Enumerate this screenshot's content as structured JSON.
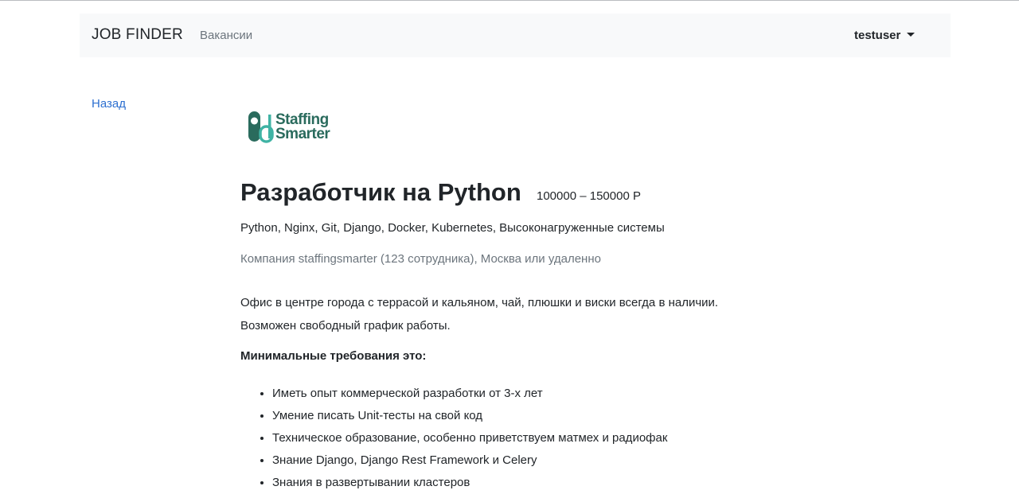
{
  "navbar": {
    "brand": "JOB FINDER",
    "vacancies_link": "Вакансии",
    "username": "testuser"
  },
  "back_link": "Назад",
  "company_logo": {
    "text_line1": "Staffing",
    "text_line2": "Smarter",
    "color": "#2a6b5d"
  },
  "vacancy": {
    "title": "Разработчик на Python",
    "salary": "100000 – 150000 Р",
    "skills": "Python, Nginx, Git, Django, Docker, Kubernetes, Высоконагруженные системы",
    "company_info": "Компания staffingsmarter (123 сотрудника), Москва или удаленно",
    "description_line1": "Офис в центре города с террасой и кальяном, чай, плюшки и виски всегда в наличии.",
    "description_line2": "Возможен свободный график работы.",
    "requirements_heading": "Минимальные требования это:",
    "requirements": [
      "Иметь опыт коммерческой разработки от 3-х лет",
      "Умение писать Unit-тесты на свой код",
      "Техническое образование, особенно приветствуем матмех и радиофак",
      "Знание Django, Django Rest Framework и Celery",
      "Знания в развертывании кластеров"
    ]
  },
  "colors": {
    "link": "#2d6fd0",
    "muted": "#6c757d",
    "navbar_bg": "#f8f9fa"
  }
}
